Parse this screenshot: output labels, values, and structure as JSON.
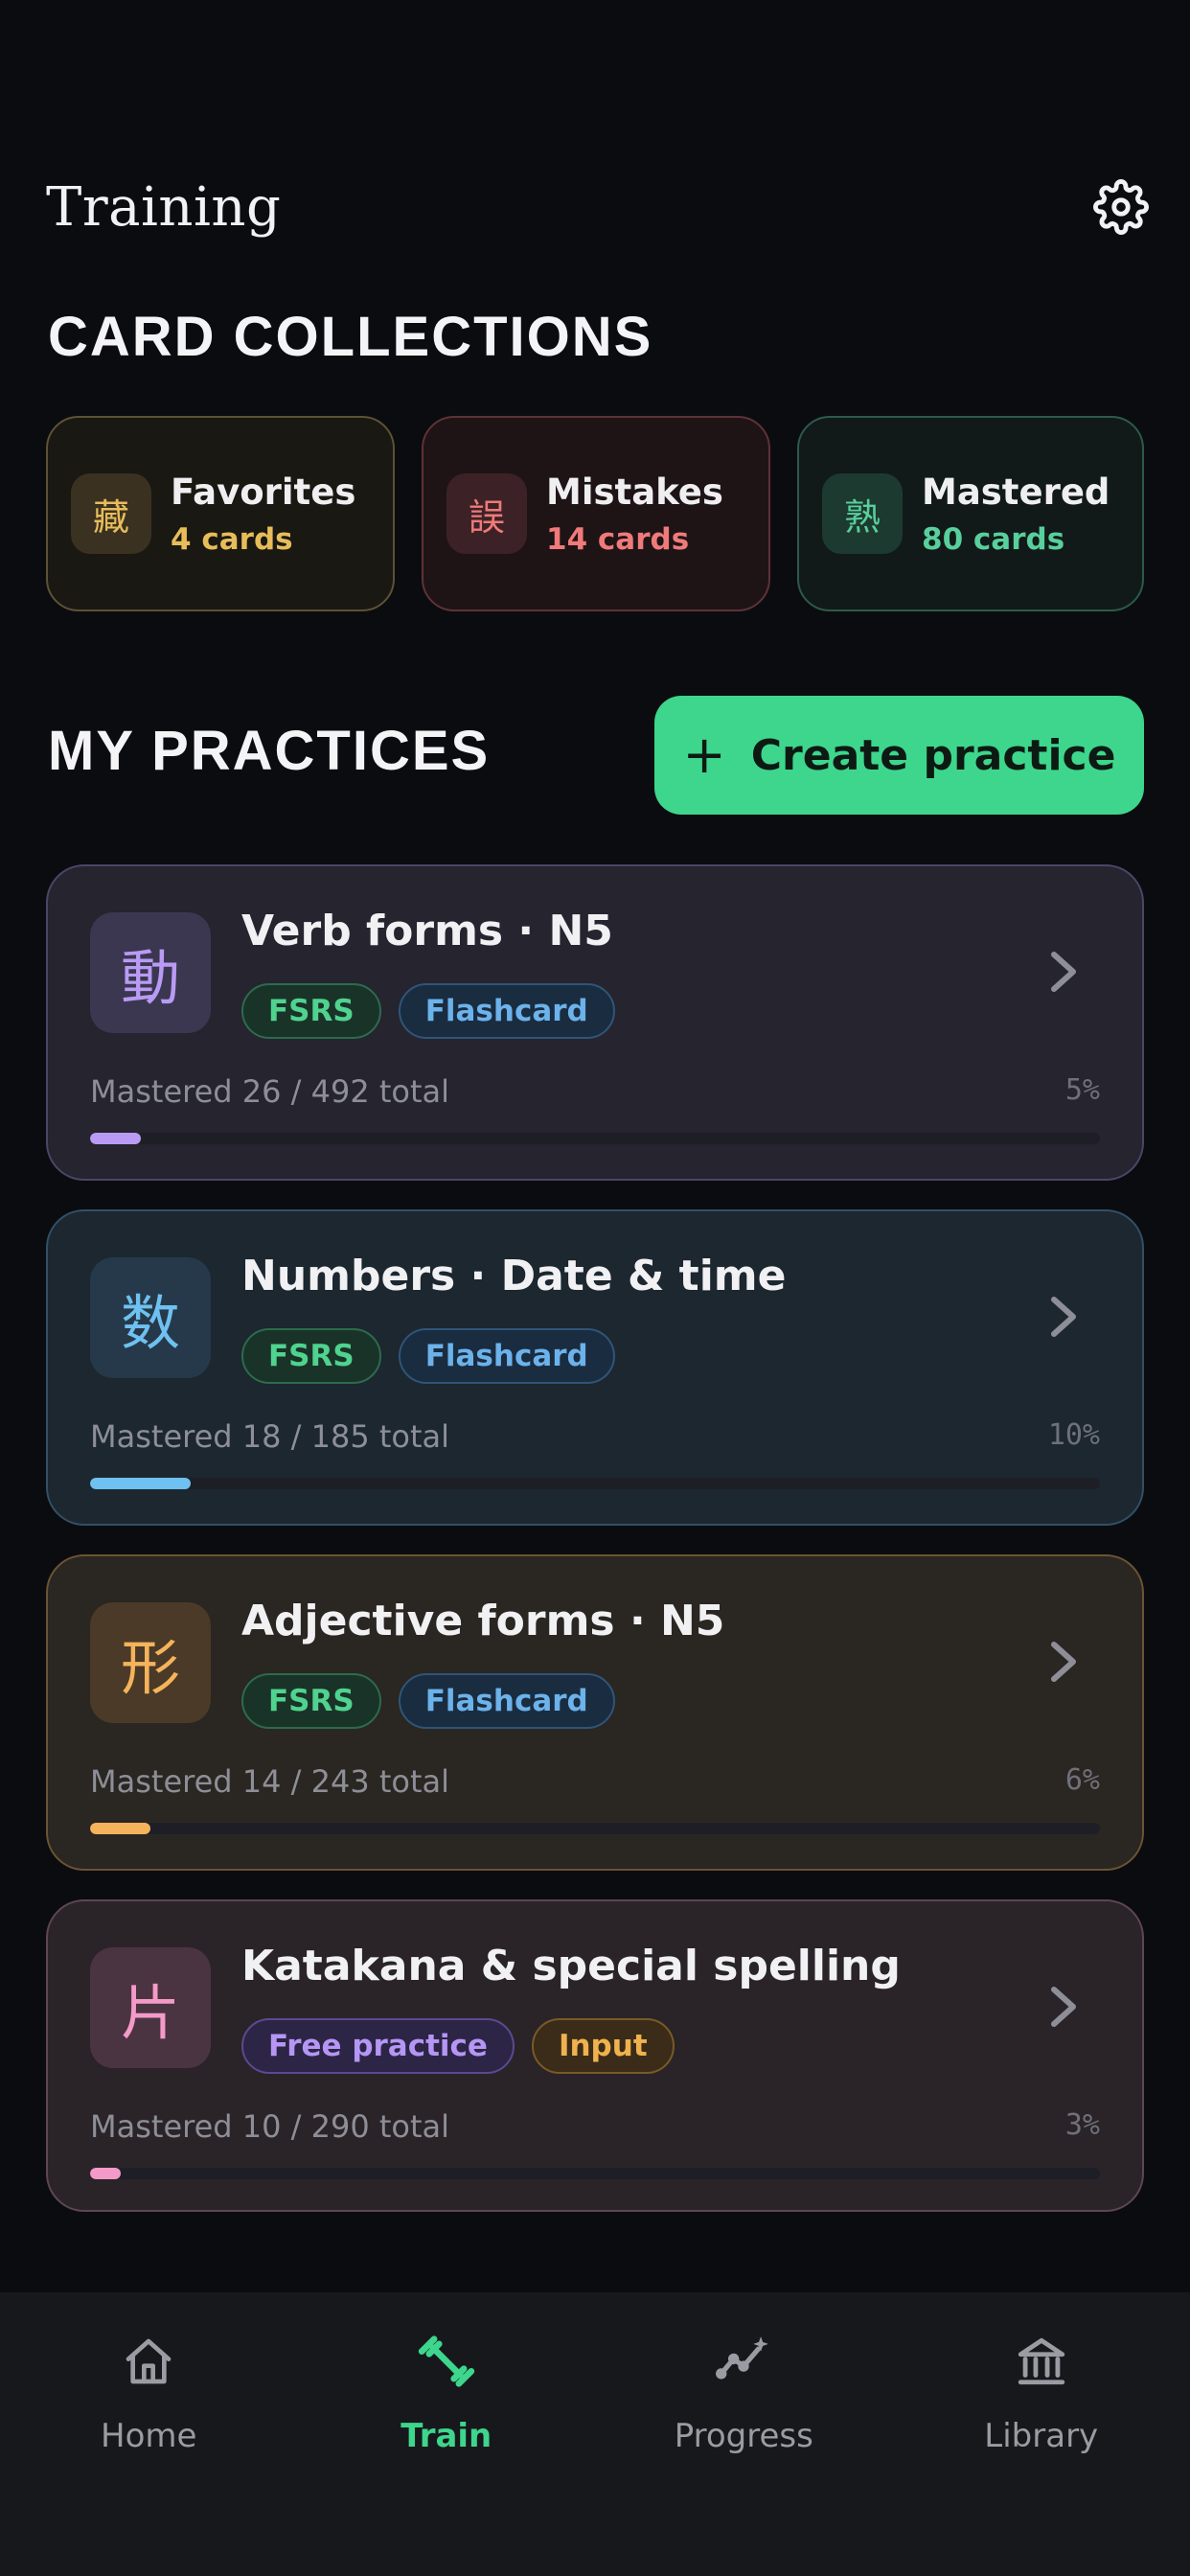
{
  "header": {
    "title": "Training",
    "settings_icon": "gear-icon"
  },
  "collections": {
    "title": "CARD COLLECTIONS",
    "items": [
      {
        "glyph": "藏",
        "name": "Favorites",
        "count": "4 cards",
        "accent": "#e7bd5a"
      },
      {
        "glyph": "誤",
        "name": "Mistakes",
        "count": "14 cards",
        "accent": "#f07a7a"
      },
      {
        "glyph": "熟",
        "name": "Mastered",
        "count": "80 cards",
        "accent": "#58cf9d"
      }
    ]
  },
  "practices": {
    "title": "MY PRACTICES",
    "create_label": "Create practice",
    "items": [
      {
        "glyph": "動",
        "title": "Verb forms · N5",
        "tags": [
          "FSRS",
          "Flashcard"
        ],
        "stats": "Mastered 26 / 492 total",
        "percent": "5%",
        "progress": 0.05,
        "accent": "#b99bf5"
      },
      {
        "glyph": "数",
        "title": "Numbers · Date & time",
        "tags": [
          "FSRS",
          "Flashcard"
        ],
        "stats": "Mastered 18 / 185 total",
        "percent": "10%",
        "progress": 0.1,
        "accent": "#6ec1f0"
      },
      {
        "glyph": "形",
        "title": "Adjective forms · N5",
        "tags": [
          "FSRS",
          "Flashcard"
        ],
        "stats": "Mastered 14 / 243 total",
        "percent": "6%",
        "progress": 0.06,
        "accent": "#f5b35c"
      },
      {
        "glyph": "片",
        "title": "Katakana & special spelling",
        "tags": [
          "Free practice",
          "Input"
        ],
        "stats": "Mastered 10 / 290 total",
        "percent": "3%",
        "progress": 0.03,
        "accent": "#f49ac8"
      }
    ]
  },
  "nav": {
    "items": [
      {
        "label": "Home",
        "icon": "home-icon",
        "active": false
      },
      {
        "label": "Train",
        "icon": "dumbbell-icon",
        "active": true
      },
      {
        "label": "Progress",
        "icon": "progress-chart-icon",
        "active": false
      },
      {
        "label": "Library",
        "icon": "library-icon",
        "active": false
      }
    ]
  },
  "colors": {
    "brand": "#3dd68c",
    "background": "#0b0c0f"
  }
}
